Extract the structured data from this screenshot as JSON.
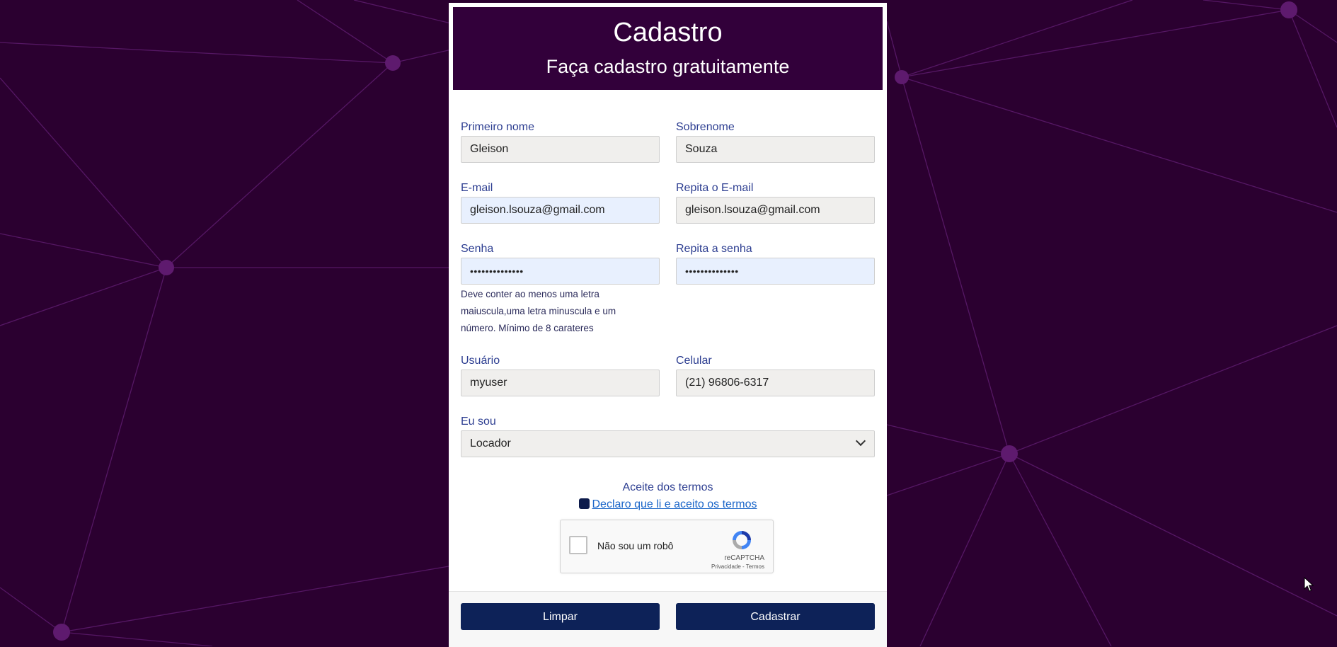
{
  "header": {
    "title": "Cadastro",
    "subtitle": "Faça cadastro gratuitamente"
  },
  "form": {
    "first_name": {
      "label": "Primeiro nome",
      "value": "Gleison"
    },
    "last_name": {
      "label": "Sobrenome",
      "value": "Souza"
    },
    "email": {
      "label": "E-mail",
      "value": "gleison.lsouza@gmail.com"
    },
    "email_repeat": {
      "label": "Repita o E-mail",
      "value": "gleison.lsouza@gmail.com"
    },
    "password": {
      "label": "Senha",
      "value": "••••••••••••••"
    },
    "password_repeat": {
      "label": "Repita a senha",
      "value": "••••••••••••••"
    },
    "password_hint": "Deve conter ao menos uma letra maiuscula,uma letra minuscula e um número. Mínimo de 8 carateres",
    "username": {
      "label": "Usuário",
      "value": "myuser"
    },
    "phone": {
      "label": "Celular",
      "value": "(21) 96806-6317"
    },
    "role": {
      "label": "Eu sou",
      "value": "Locador"
    }
  },
  "terms": {
    "title": "Aceite dos termos",
    "link": "Declaro que li e aceito os termos",
    "checked": true
  },
  "captcha": {
    "label": "Não sou um robô",
    "brand": "reCAPTCHA",
    "links": "Privacidade - Termos"
  },
  "footer": {
    "clear_label": "Limpar",
    "submit_label": "Cadastrar"
  },
  "colors": {
    "background": "#2b0030",
    "header_bg": "#32003a",
    "label": "#2d3e91",
    "button": "#0d2258"
  }
}
